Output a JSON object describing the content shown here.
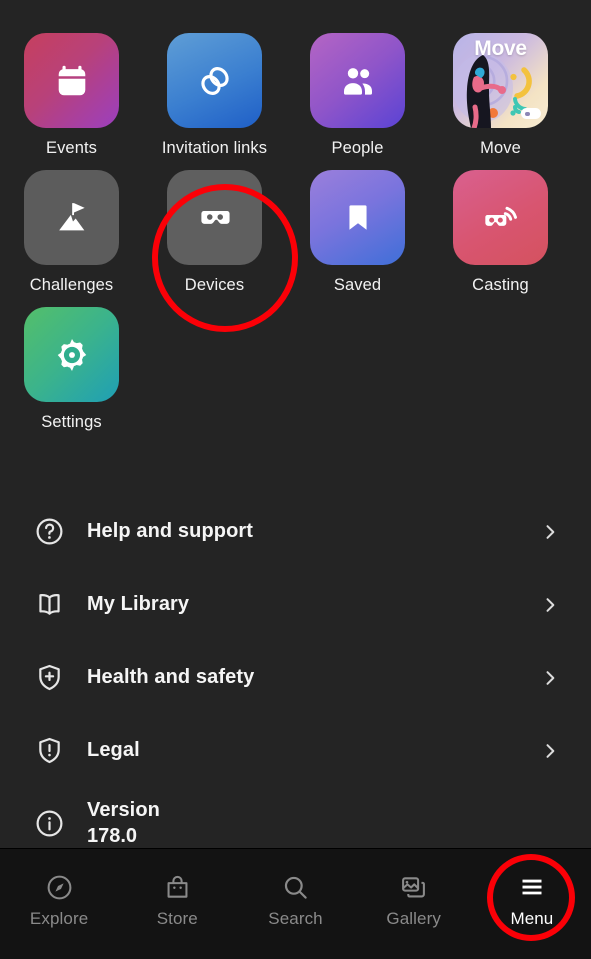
{
  "screen": {
    "background": "#242424",
    "nav_background": "#131313",
    "annotation_color": "#fb0007"
  },
  "tiles": [
    {
      "id": "events",
      "label": "Events",
      "icon": "calendar-icon",
      "style": "g-events"
    },
    {
      "id": "invites",
      "label": "Invitation links",
      "icon": "link-chain-icon",
      "style": "g-invites"
    },
    {
      "id": "people",
      "label": "People",
      "icon": "people-icon",
      "style": "g-people"
    },
    {
      "id": "move",
      "label": "Move",
      "icon": "move-artwork",
      "style": "g-move",
      "artwork_word": "Move"
    },
    {
      "id": "challenges",
      "label": "Challenges",
      "icon": "mountain-flag-icon",
      "style": "g-challenges"
    },
    {
      "id": "devices",
      "label": "Devices",
      "icon": "vr-headset-icon",
      "style": "g-devices",
      "annotated": true
    },
    {
      "id": "saved",
      "label": "Saved",
      "icon": "bookmark-icon",
      "style": "g-saved"
    },
    {
      "id": "casting",
      "label": "Casting",
      "icon": "cast-headset-icon",
      "style": "g-casting"
    },
    {
      "id": "settings",
      "label": "Settings",
      "icon": "gear-icon",
      "style": "g-settings"
    }
  ],
  "list": [
    {
      "id": "help",
      "label": "Help and support",
      "icon": "question-circle-icon",
      "chevron": "chevron-right-icon"
    },
    {
      "id": "library",
      "label": "My Library",
      "icon": "book-icon",
      "chevron": "chevron-right-icon"
    },
    {
      "id": "health",
      "label": "Health and safety",
      "icon": "shield-plus-icon",
      "chevron": "chevron-right-icon"
    },
    {
      "id": "legal",
      "label": "Legal",
      "icon": "shield-alert-icon",
      "chevron": "chevron-right-icon"
    }
  ],
  "version": {
    "label": "Version",
    "value": "178.0",
    "icon": "info-circle-icon"
  },
  "navbar": {
    "items": [
      {
        "id": "explore",
        "label": "Explore",
        "icon": "compass-icon",
        "active": false
      },
      {
        "id": "store",
        "label": "Store",
        "icon": "shop-bag-icon",
        "active": false
      },
      {
        "id": "search",
        "label": "Search",
        "icon": "search-icon",
        "active": false
      },
      {
        "id": "gallery",
        "label": "Gallery",
        "icon": "gallery-icon",
        "active": false
      },
      {
        "id": "menu",
        "label": "Menu",
        "icon": "hamburger-icon",
        "active": true
      }
    ]
  }
}
